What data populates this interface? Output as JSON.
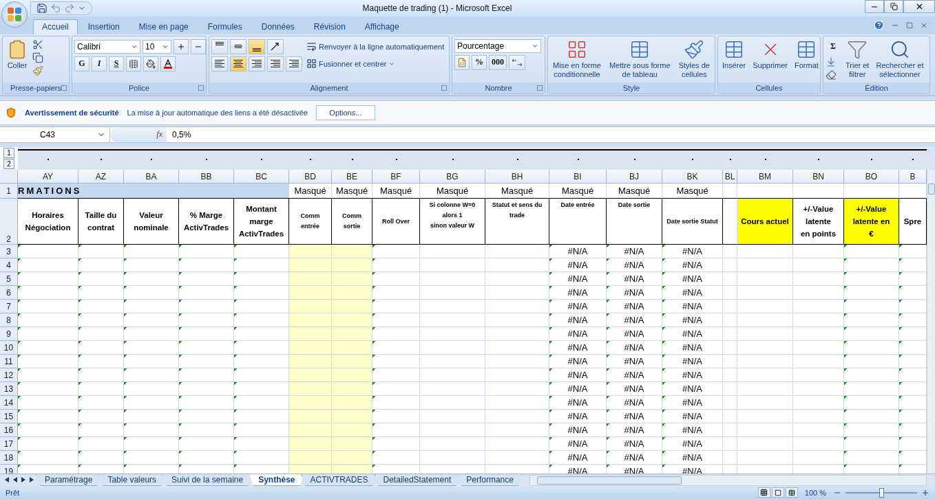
{
  "window": {
    "title": "Maquette de trading (1) - Microsoft Excel"
  },
  "ribbon": {
    "tabs": [
      {
        "label": "Accueil",
        "selected": true
      },
      {
        "label": "Insertion",
        "selected": false
      },
      {
        "label": "Mise en page",
        "selected": false
      },
      {
        "label": "Formules",
        "selected": false
      },
      {
        "label": "Données",
        "selected": false
      },
      {
        "label": "Révision",
        "selected": false
      },
      {
        "label": "Affichage",
        "selected": false
      }
    ],
    "clipboard": {
      "title": "Presse-papiers",
      "paste": "Coller"
    },
    "font": {
      "title": "Police",
      "font_name": "Calibri",
      "font_size": "10",
      "style_buttons": [
        "G",
        "I",
        "S"
      ]
    },
    "alignment": {
      "title": "Alignement",
      "wrap": "Renvoyer à la ligne automatiquement",
      "merge": "Fusionner et centrer",
      "vertical_buttons": [
        {
          "selected": false
        },
        {
          "selected": false
        },
        {
          "selected": true
        }
      ],
      "horizontal_buttons": [
        {
          "selected": false
        },
        {
          "selected": true
        },
        {
          "selected": false
        }
      ]
    },
    "number": {
      "title": "Nombre",
      "format": "Pourcentage",
      "percent": "%",
      "thousands": "000"
    },
    "styles": {
      "title": "Style",
      "buttons": [
        {
          "lines": [
            "Mise en forme",
            "conditionnelle"
          ]
        },
        {
          "lines": [
            "Mettre sous forme",
            "de tableau"
          ]
        },
        {
          "lines": [
            "Styles de",
            "cellules"
          ]
        }
      ]
    },
    "cells": {
      "title": "Cellules",
      "buttons": [
        "Insérer",
        "Supprimer",
        "Format"
      ]
    },
    "editing": {
      "title": "Édition",
      "sigma": "Σ",
      "buttons": [
        {
          "lines": [
            "Trier et",
            "filtrer"
          ]
        },
        {
          "lines": [
            "Rechercher et",
            "sélectionner"
          ]
        }
      ]
    }
  },
  "security_bar": {
    "title": "Avertissement de sécurité",
    "message": "La mise à jour automatique des liens a été désactivée",
    "button": "Options..."
  },
  "formula_bar": {
    "name_box": "C43",
    "fx": "fx",
    "value": "0,5%"
  },
  "outline": {
    "levels": [
      "1",
      "2"
    ]
  },
  "sheet": {
    "band_title": "RMATIONS",
    "header_rows": [
      "1",
      "2"
    ],
    "columns": [
      {
        "letter": "AY",
        "header": [
          "Horaires",
          "Négociation"
        ],
        "kind": "normal",
        "flag": true
      },
      {
        "letter": "AZ",
        "header": [
          "Taille du",
          "contrat"
        ],
        "kind": "normal",
        "flag": true
      },
      {
        "letter": "BA",
        "header": [
          "Valeur",
          "nominale"
        ],
        "kind": "normal",
        "flag": true
      },
      {
        "letter": "BB",
        "header": [
          "% Marge",
          "ActivTrades"
        ],
        "kind": "normal",
        "flag": true
      },
      {
        "letter": "BC",
        "header": [
          "Montant",
          "marge",
          "ActivTrades"
        ],
        "kind": "normal",
        "flag": true
      },
      {
        "letter": "BD",
        "row_1": "Masqué",
        "header": [
          "Comm",
          "entrée"
        ],
        "kind": "small",
        "shaded": true
      },
      {
        "letter": "BE",
        "row_1": "Masqué",
        "header": [
          "Comm",
          "sortie"
        ],
        "kind": "small",
        "shaded": true
      },
      {
        "letter": "BF",
        "row_1": "Masqué",
        "header": [
          "Roll Over"
        ],
        "kind": "small",
        "flag": true
      },
      {
        "letter": "BG",
        "row_1": "Masqué",
        "header": [
          "Si colonne W=0",
          "alors 1",
          "sinon valeur W"
        ],
        "kind": "top"
      },
      {
        "letter": "BH",
        "row_1": "Masqué",
        "header": [
          "Statut et sens du",
          "trade"
        ],
        "kind": "top"
      },
      {
        "letter": "BI",
        "row_1": "Masqué",
        "header": [
          "Date entrée"
        ],
        "kind": "top",
        "flag": true,
        "has_values": true
      },
      {
        "letter": "BJ",
        "row_1": "Masqué",
        "header": [
          "Date sortie"
        ],
        "kind": "top",
        "flag": true,
        "has_values": true
      },
      {
        "letter": "BK",
        "row_1": "Masqué",
        "header": [
          "Date sortie Statut"
        ],
        "kind": "small",
        "flag": true,
        "has_values": true
      },
      {
        "letter": "BL"
      },
      {
        "letter": "BM",
        "header": [
          "Cours actuel"
        ],
        "kind": "normal",
        "highlighted": true
      },
      {
        "letter": "BN",
        "header": [
          "+/-Value",
          "latente",
          "en points"
        ],
        "kind": "normal"
      },
      {
        "letter": "BO",
        "header": [
          "+/-Value",
          "latente en",
          "€"
        ],
        "kind": "normal",
        "highlighted": true,
        "flag": true
      },
      {
        "letter": "B",
        "header": [
          "Spre"
        ],
        "kind": "normal",
        "flag": true
      }
    ],
    "rows": [
      {
        "number": "3",
        "values": [
          "#N/A",
          "#N/A",
          "#N/A"
        ]
      },
      {
        "number": "4",
        "values": [
          "#N/A",
          "#N/A",
          "#N/A"
        ]
      },
      {
        "number": "5",
        "values": [
          "#N/A",
          "#N/A",
          "#N/A"
        ]
      },
      {
        "number": "6",
        "values": [
          "#N/A",
          "#N/A",
          "#N/A"
        ]
      },
      {
        "number": "7",
        "values": [
          "#N/A",
          "#N/A",
          "#N/A"
        ]
      },
      {
        "number": "8",
        "values": [
          "#N/A",
          "#N/A",
          "#N/A"
        ]
      },
      {
        "number": "9",
        "values": [
          "#N/A",
          "#N/A",
          "#N/A"
        ]
      },
      {
        "number": "10",
        "values": [
          "#N/A",
          "#N/A",
          "#N/A"
        ]
      },
      {
        "number": "11",
        "values": [
          "#N/A",
          "#N/A",
          "#N/A"
        ]
      },
      {
        "number": "12",
        "values": [
          "#N/A",
          "#N/A",
          "#N/A"
        ]
      },
      {
        "number": "13",
        "values": [
          "#N/A",
          "#N/A",
          "#N/A"
        ]
      },
      {
        "number": "14",
        "values": [
          "#N/A",
          "#N/A",
          "#N/A"
        ]
      },
      {
        "number": "15",
        "values": [
          "#N/A",
          "#N/A",
          "#N/A"
        ]
      },
      {
        "number": "16",
        "values": [
          "#N/A",
          "#N/A",
          "#N/A"
        ]
      },
      {
        "number": "17",
        "values": [
          "#N/A",
          "#N/A",
          "#N/A"
        ]
      },
      {
        "number": "18",
        "values": [
          "#N/A",
          "#N/A",
          "#N/A"
        ]
      },
      {
        "number": "19",
        "values": [
          "#N/A",
          "#N/A",
          "#N/A"
        ]
      }
    ]
  },
  "sheet_tabs": [
    {
      "label": "Paramétrage",
      "selected": false
    },
    {
      "label": "Table valeurs",
      "selected": false
    },
    {
      "label": "Suivi de la semaine",
      "selected": false
    },
    {
      "label": "Synthèse",
      "selected": true
    },
    {
      "label": "ACTIVTRADES",
      "selected": false
    },
    {
      "label": "DetailedStatement",
      "selected": false
    },
    {
      "label": "Performance",
      "selected": false
    }
  ],
  "status_bar": {
    "status": "Prêt",
    "zoom": "100 %",
    "zoom_slider": {
      "level": 0.5
    }
  }
}
